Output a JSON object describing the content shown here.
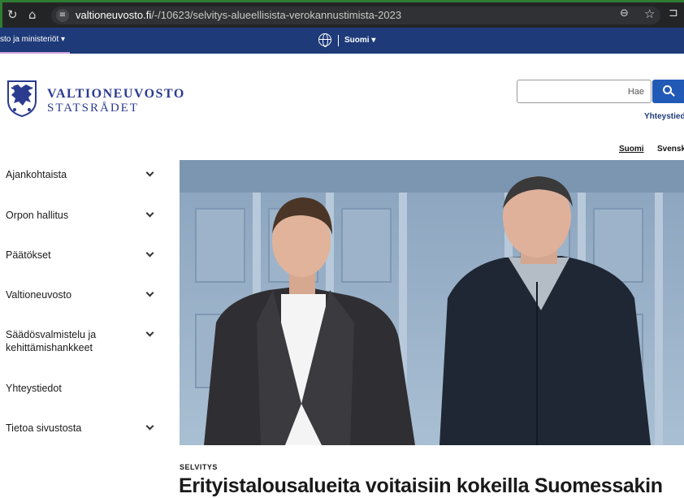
{
  "browser": {
    "url_host": "valtioneuvosto.fi",
    "url_path": "/-/10623/selvitys-alueellisista-verokannustimista-2023",
    "icons": [
      "back-icon",
      "home-icon",
      "site-info-icon",
      "zoom-icon",
      "star-icon",
      "extensions-icon"
    ]
  },
  "topbar": {
    "sites_label": "sto ja ministeriöt ▾",
    "language": "Suomi ▾",
    "colors": {
      "background": "#1e3a78",
      "accent_underline": "#c9a0dc"
    }
  },
  "header": {
    "logo_fi": "VALTIONEUVOSTO",
    "logo_sv": "STATSRÅDET",
    "search_placeholder": "Hae",
    "contact_link": "Yhteystiedot",
    "lang_fi": "Suomi",
    "lang_sv": "Svenska",
    "colors": {
      "brand": "#2b3b8f",
      "search_button": "#2159b6"
    }
  },
  "sidebar": {
    "items": [
      {
        "label": "Ajankohtaista",
        "expandable": true
      },
      {
        "label": "Orpon hallitus",
        "expandable": true
      },
      {
        "label": "Päätökset",
        "expandable": true
      },
      {
        "label": "Valtioneuvosto",
        "expandable": true
      },
      {
        "label": "Säädösvalmistelu ja kehittämishankkeet",
        "expandable": true
      },
      {
        "label": "Yhteystiedot",
        "expandable": false
      },
      {
        "label": "Tietoa sivustosta",
        "expandable": true
      }
    ]
  },
  "article": {
    "kicker": "SELVITYS",
    "headline": "Erityistalousalueita voitaisiin kokeilla Suomessakin"
  }
}
